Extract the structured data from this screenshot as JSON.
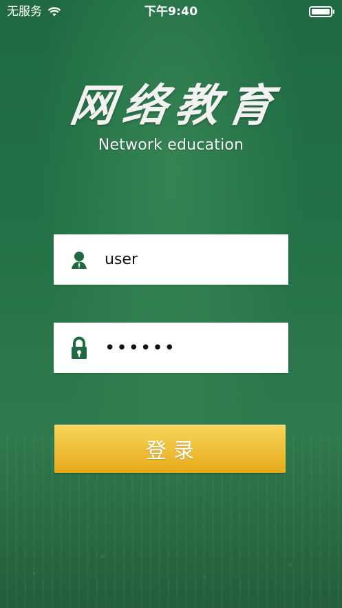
{
  "status_bar": {
    "carrier": "无服务",
    "time": "下午9:40",
    "wifi_icon": "wifi-icon",
    "battery_icon": "battery-icon"
  },
  "logo": {
    "chinese_title": "网络教育",
    "english_title": "Network education"
  },
  "form": {
    "username": {
      "value": "user",
      "icon": "user-icon"
    },
    "password": {
      "value": "••••••",
      "icon": "lock-icon"
    },
    "login_button_label": "登录"
  },
  "colors": {
    "background_green": "#236f47",
    "icon_green": "#1f6a43",
    "button_yellow": "#f0c23f"
  }
}
